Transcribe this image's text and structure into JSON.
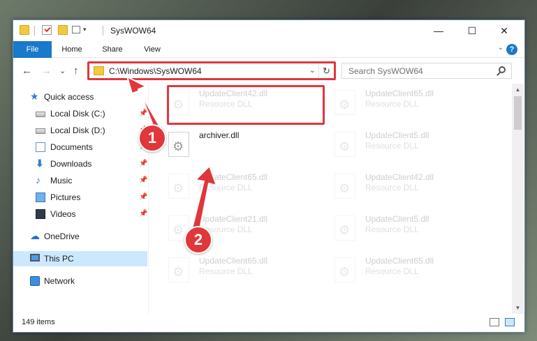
{
  "window": {
    "title": "SysWOW64",
    "minimize": "—",
    "maximize": "☐",
    "close": "✕"
  },
  "ribbon": {
    "tabs": [
      "File",
      "Home",
      "Share",
      "View"
    ],
    "collapse": "⌄",
    "help": "?"
  },
  "nav": {
    "back": "←",
    "forward": "→",
    "recent": "⌄",
    "up": "↑",
    "address": "C:\\Windows\\SysWOW64",
    "address_dropdown": "⌄",
    "refresh": "↻",
    "search_placeholder": "Search SysWOW64"
  },
  "sidebar": {
    "items": [
      {
        "label": "Quick access",
        "icon": "star-icon"
      },
      {
        "label": "Local Disk (C:)",
        "icon": "disk-icon",
        "pinned": true
      },
      {
        "label": "Local Disk (D:)",
        "icon": "disk-icon",
        "pinned": true
      },
      {
        "label": "Documents",
        "icon": "documents-icon",
        "pinned": true
      },
      {
        "label": "Downloads",
        "icon": "downloads-icon",
        "pinned": true
      },
      {
        "label": "Music",
        "icon": "music-icon",
        "pinned": true
      },
      {
        "label": "Pictures",
        "icon": "pictures-icon",
        "pinned": true
      },
      {
        "label": "Videos",
        "icon": "videos-icon",
        "pinned": true
      },
      {
        "label": "OneDrive",
        "icon": "onedrive-icon"
      },
      {
        "label": "This PC",
        "icon": "pc-icon",
        "selected": true
      },
      {
        "label": "Network",
        "icon": "network-icon"
      }
    ],
    "pin_glyph": "📌"
  },
  "files": {
    "left_column": [
      {
        "name": "UpdateClient42.dll",
        "type": "Resource DLL"
      },
      {
        "name": "archiver.dll",
        "type": ""
      },
      {
        "name": "UpdateClient65.dll",
        "type": "Resource DLL"
      },
      {
        "name": "UpdateClient21.dll",
        "type": "Resource DLL"
      },
      {
        "name": "UpdateClient65.dll",
        "type": "Resource DLL"
      }
    ],
    "right_column": [
      {
        "name": "UpdateClient65.dll",
        "type": "Resource DLL"
      },
      {
        "name": "UpdateClient5.dll",
        "type": "Resource DLL"
      },
      {
        "name": "UpdateClient42.dll",
        "type": "Resource DLL"
      },
      {
        "name": "UpdateClient5.dll",
        "type": "Resource DLL"
      },
      {
        "name": "UpdateClient65.dll",
        "type": "Resource DLL"
      }
    ]
  },
  "status": {
    "count": "149 items"
  },
  "annotations": {
    "badge1": "1",
    "badge2": "2",
    "color": "#e0373b"
  },
  "colors": {
    "accent": "#1979ca",
    "selection": "#cce8ff"
  }
}
